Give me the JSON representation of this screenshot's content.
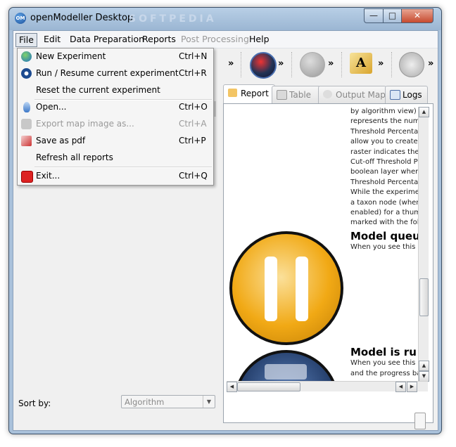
{
  "window": {
    "title": "openModeller Desktop",
    "watermark": "SOFTPEDIA",
    "controls": {
      "minimize": "—",
      "maximize": "□",
      "close": "✕"
    }
  },
  "menubar": {
    "items": [
      {
        "label": "File"
      },
      {
        "label": "Edit"
      },
      {
        "label": "Data Preparation"
      },
      {
        "label": "Reports"
      },
      {
        "label": "Post Processing"
      },
      {
        "label": "Help"
      }
    ]
  },
  "file_menu": {
    "items": [
      {
        "label": "New Experiment",
        "shortcut": "Ctrl+N",
        "icon": "globe-icon"
      },
      {
        "label": "Run / Resume current experiment",
        "shortcut": "Ctrl+R",
        "icon": "run-icon"
      },
      {
        "label": "Reset the current experiment",
        "shortcut": "",
        "icon": ""
      },
      {
        "label": "Open...",
        "shortcut": "Ctrl+O",
        "icon": "open-icon"
      },
      {
        "label": "Export map image as...",
        "shortcut": "Ctrl+A",
        "icon": "export-icon"
      },
      {
        "label": "Save as pdf",
        "shortcut": "Ctrl+P",
        "icon": "pdf-icon"
      },
      {
        "label": "Refresh all reports",
        "shortcut": "",
        "icon": ""
      },
      {
        "label": "Exit...",
        "shortcut": "Ctrl+Q",
        "icon": "exit-icon"
      }
    ]
  },
  "toolbar": {
    "arrows": [
      "»",
      "»",
      "»",
      "»",
      "»"
    ],
    "icons": [
      "model-globe-icon",
      "disabled-cluster-icon",
      "layer-text-icon",
      "camera-icon"
    ]
  },
  "tabs": [
    {
      "label": "Report",
      "icon": "report-icon"
    },
    {
      "label": "Table",
      "icon": "table-icon"
    },
    {
      "label": "Output Map",
      "icon": "output-map-icon"
    },
    {
      "label": "Logs",
      "icon": "logs-icon"
    }
  ],
  "report": {
    "lines": [
      "by algorithm view) w",
      "represents the numb",
      "Threshold Percentag",
      "allow you to create a",
      "raster indicates the ",
      "Cut-off Threshold Pe",
      "boolean layer where",
      "Threshold Percentag",
      "While the experimen",
      "a taxon node (when",
      "enabled) for a thumb",
      "marked with the follo"
    ],
    "heading1": "Model queu",
    "text1": "When you see this ic",
    "heading2": "Model is ru",
    "text2a": "When you see this ic",
    "text2b": "and the progress ba"
  },
  "sort": {
    "label": "Sort by:",
    "value": "Algorithm"
  },
  "colors": {
    "titlebar": "#9bb6d3",
    "pause_orange": "#f1a915",
    "run_blue": "#243e6b"
  }
}
